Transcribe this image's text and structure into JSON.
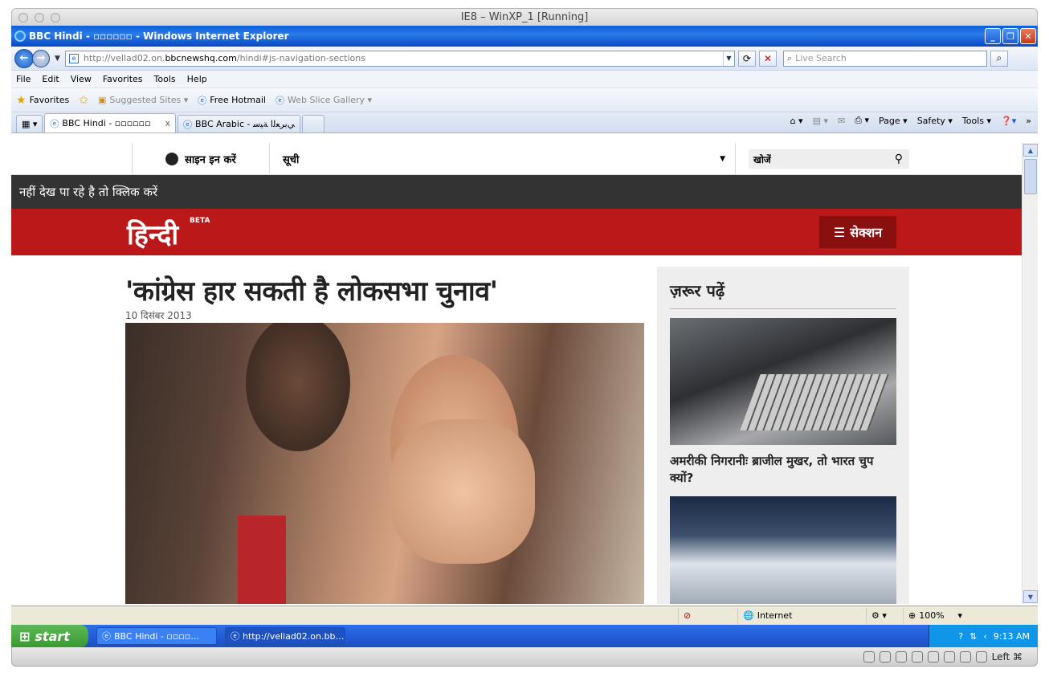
{
  "mac_window": {
    "title": "IE8 – WinXP_1 [Running]"
  },
  "ie": {
    "window_title": "BBC Hindi - ▫▫▫▫▫▫ - Windows Internet Explorer",
    "address": {
      "prefix": "http://vellad02.on.",
      "host": "bbcnewshq.com",
      "path": "/hindi#js-navigation-sections"
    },
    "live_search_placeholder": "Live Search",
    "menu": [
      "File",
      "Edit",
      "View",
      "Favorites",
      "Tools",
      "Help"
    ],
    "favorites": {
      "label": "Favorites",
      "items": [
        "Suggested Sites ▾",
        "Free Hotmail",
        "Web Slice Gallery ▾"
      ]
    },
    "tabs": [
      {
        "label": "BBC Hindi - ▫▫▫▫▫▫"
      },
      {
        "label": "BBC Arabic - ﻲﺑﺮﻌﻟا ﺔﻴﺳ"
      }
    ],
    "tab_tools": [
      "Page ▾",
      "Safety ▾",
      "Tools ▾"
    ],
    "status": {
      "zone": "Internet",
      "zoom": "100%"
    }
  },
  "site": {
    "signin": "साइन इन करें",
    "list": "सूची",
    "search": "खोजें",
    "notice": "नहीं देख पा रहे है तो क्लिक करें",
    "logo": "हिन्दी",
    "beta": "BETA",
    "sections": "सेक्शन",
    "headline": "'कांग्रेस हार सकती है लोकसभा चुनाव'",
    "date": "10 दिसंबर 2013",
    "aside": {
      "title": "ज़रूर पढ़ें",
      "card1_title": "अमरीकी निगरानीः ब्राजील मुखर, तो भारत चुप क्यों?"
    }
  },
  "taskbar": {
    "start": "start",
    "tasks": [
      "BBC Hindi - ▫▫▫▫…",
      "http://vellad02.on.bb…"
    ],
    "clock": "9:13 AM"
  },
  "vbox": {
    "host_key": "Left ⌘"
  }
}
